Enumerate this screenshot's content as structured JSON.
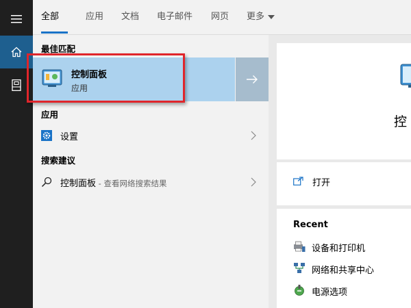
{
  "rail": {
    "items": [
      {
        "icon": "hamburger-menu-icon"
      },
      {
        "icon": "home-icon",
        "active": true
      },
      {
        "icon": "notebook-icon"
      }
    ]
  },
  "tabs": {
    "items": [
      {
        "label": "全部",
        "active": true
      },
      {
        "label": "应用"
      },
      {
        "label": "文档"
      },
      {
        "label": "电子邮件"
      },
      {
        "label": "网页"
      },
      {
        "label": "更多"
      }
    ]
  },
  "results": {
    "best_match_header": "最佳匹配",
    "best_match": {
      "title": "控制面板",
      "subtitle": "应用",
      "icon": "control-panel-icon"
    },
    "apps_header": "应用",
    "apps": [
      {
        "label": "设置",
        "icon": "gear-icon"
      }
    ],
    "suggestions_header": "搜索建议",
    "suggestions": [
      {
        "label": "控制面板",
        "hint": " - 查看网络搜索结果",
        "icon": "search-icon"
      }
    ]
  },
  "preview": {
    "title": "控",
    "open_label": "打开",
    "recent_header": "Recent",
    "recent": [
      {
        "label": "设备和打印机",
        "icon": "devices-printers-icon"
      },
      {
        "label": "网络和共享中心",
        "icon": "network-sharing-icon"
      },
      {
        "label": "电源选项",
        "icon": "power-options-icon"
      }
    ]
  },
  "colors": {
    "accent": "#1a73c7",
    "selection": "#acd2ee",
    "highlight_box": "#e0252b"
  }
}
